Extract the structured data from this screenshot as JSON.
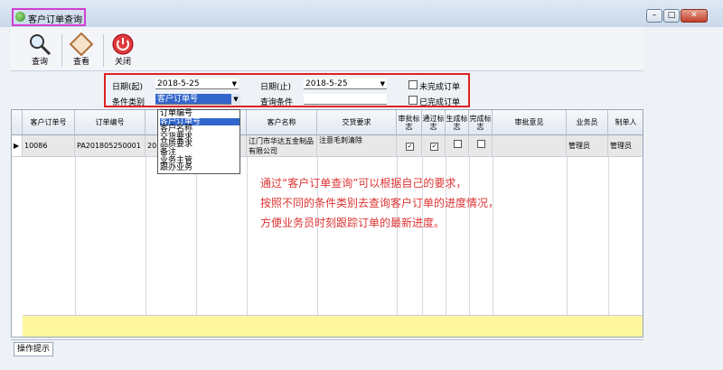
{
  "window": {
    "title": "客户订单查询",
    "btn_min": "–",
    "btn_max": "□",
    "btn_close": "✕"
  },
  "toolbar": {
    "query": "查询",
    "view": "查看",
    "close": "关闭"
  },
  "filters": {
    "date_from_label": "日期(起)",
    "date_from": "2018-5-25",
    "date_to_label": "日期(止)",
    "date_to": "2018-5-25",
    "category_label": "条件类别",
    "category_value": "客户订单号",
    "condition_label": "查询条件",
    "condition_value": "",
    "unfinished_label": "未完成订单",
    "finished_label": "已完成订单"
  },
  "dropdown_options": [
    "订单编号",
    "客户订单号",
    "客户名称",
    "交货要求",
    "品质要求",
    "备注",
    "业务主管",
    "跟办业务"
  ],
  "columns": [
    "客户订单号",
    "订单编号",
    "",
    "",
    "客户名称",
    "交货要求",
    "审批标志",
    "通过标志",
    "生成标志",
    "完成标志",
    "审批意见",
    "业务员",
    "制单人"
  ],
  "row": {
    "customer_order": "10086",
    "order_no": "PA201805250001",
    "date_part": "201",
    "customer_name": "江门市华达五金制品有限公司",
    "delivery": "注意毛刺清除",
    "approve": true,
    "pass": true,
    "generate": false,
    "complete": false,
    "salesman": "管理员",
    "maker": "管理员"
  },
  "note": {
    "line1": "通过“客户订单查询”可以根据自己的要求，",
    "line2": "按照不同的条件类别去查询客户订单的进度情况，",
    "line3": "方便业务员时刻跟踪订单的最新进度。"
  },
  "status": {
    "tab": "操作提示"
  }
}
